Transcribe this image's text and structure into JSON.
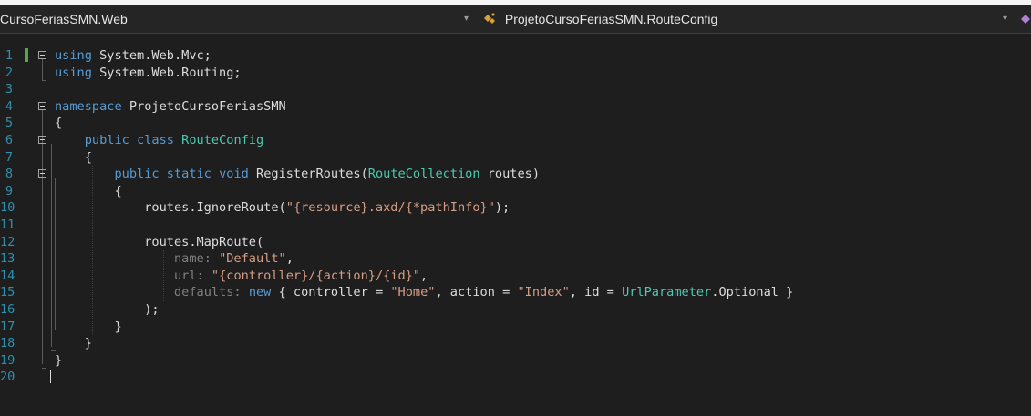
{
  "navbar": {
    "project": "CursoFeriasSMN.Web",
    "class_path": "ProjetoCursoFeriasSMN.RouteConfig",
    "class_icon": "class-icon",
    "dropdown_glyph": "▾"
  },
  "lines": [
    {
      "num": "1",
      "tokens": [
        {
          "t": "using",
          "c": "kw"
        },
        {
          "t": " System.Web.Mvc;",
          "c": ""
        }
      ]
    },
    {
      "num": "2",
      "tokens": [
        {
          "t": "using",
          "c": "kw"
        },
        {
          "t": " System.Web.Routing;",
          "c": ""
        }
      ]
    },
    {
      "num": "3",
      "tokens": []
    },
    {
      "num": "4",
      "tokens": [
        {
          "t": "namespace",
          "c": "kw"
        },
        {
          "t": " ProjetoCursoFeriasSMN",
          "c": ""
        }
      ]
    },
    {
      "num": "5",
      "tokens": [
        {
          "t": "{",
          "c": ""
        }
      ]
    },
    {
      "num": "6",
      "tokens": [
        {
          "t": "    ",
          "c": ""
        },
        {
          "t": "public",
          "c": "kw"
        },
        {
          "t": " ",
          "c": ""
        },
        {
          "t": "class",
          "c": "kw"
        },
        {
          "t": " ",
          "c": ""
        },
        {
          "t": "RouteConfig",
          "c": "ty"
        }
      ]
    },
    {
      "num": "7",
      "tokens": [
        {
          "t": "    {",
          "c": ""
        }
      ]
    },
    {
      "num": "8",
      "tokens": [
        {
          "t": "        ",
          "c": ""
        },
        {
          "t": "public",
          "c": "kw"
        },
        {
          "t": " ",
          "c": ""
        },
        {
          "t": "static",
          "c": "kw"
        },
        {
          "t": " ",
          "c": ""
        },
        {
          "t": "void",
          "c": "kw"
        },
        {
          "t": " RegisterRoutes(",
          "c": ""
        },
        {
          "t": "RouteCollection",
          "c": "ty"
        },
        {
          "t": " routes)",
          "c": ""
        }
      ]
    },
    {
      "num": "9",
      "tokens": [
        {
          "t": "        {",
          "c": ""
        }
      ]
    },
    {
      "num": "10",
      "tokens": [
        {
          "t": "            routes.IgnoreRoute(",
          "c": ""
        },
        {
          "t": "\"{resource}.axd/{*pathInfo}\"",
          "c": "st"
        },
        {
          "t": ");",
          "c": ""
        }
      ]
    },
    {
      "num": "11",
      "tokens": []
    },
    {
      "num": "12",
      "tokens": [
        {
          "t": "            routes.MapRoute(",
          "c": ""
        }
      ]
    },
    {
      "num": "13",
      "tokens": [
        {
          "t": "                ",
          "c": ""
        },
        {
          "t": "name:",
          "c": "pn"
        },
        {
          "t": " ",
          "c": ""
        },
        {
          "t": "\"Default\"",
          "c": "st"
        },
        {
          "t": ",",
          "c": ""
        }
      ]
    },
    {
      "num": "14",
      "tokens": [
        {
          "t": "                ",
          "c": ""
        },
        {
          "t": "url:",
          "c": "pn"
        },
        {
          "t": " ",
          "c": ""
        },
        {
          "t": "\"{controller}/{action}/{id}\"",
          "c": "st"
        },
        {
          "t": ",",
          "c": ""
        }
      ]
    },
    {
      "num": "15",
      "tokens": [
        {
          "t": "                ",
          "c": ""
        },
        {
          "t": "defaults:",
          "c": "pn"
        },
        {
          "t": " ",
          "c": ""
        },
        {
          "t": "new",
          "c": "kw"
        },
        {
          "t": " { controller = ",
          "c": ""
        },
        {
          "t": "\"Home\"",
          "c": "st"
        },
        {
          "t": ", action = ",
          "c": ""
        },
        {
          "t": "\"Index\"",
          "c": "st"
        },
        {
          "t": ", id = ",
          "c": ""
        },
        {
          "t": "UrlParameter",
          "c": "ty"
        },
        {
          "t": ".Optional }",
          "c": ""
        }
      ]
    },
    {
      "num": "16",
      "tokens": [
        {
          "t": "            );",
          "c": ""
        }
      ]
    },
    {
      "num": "17",
      "tokens": [
        {
          "t": "        }",
          "c": ""
        }
      ]
    },
    {
      "num": "18",
      "tokens": [
        {
          "t": "    }",
          "c": ""
        }
      ]
    },
    {
      "num": "19",
      "tokens": [
        {
          "t": "}",
          "c": ""
        }
      ]
    },
    {
      "num": "20",
      "tokens": []
    }
  ]
}
